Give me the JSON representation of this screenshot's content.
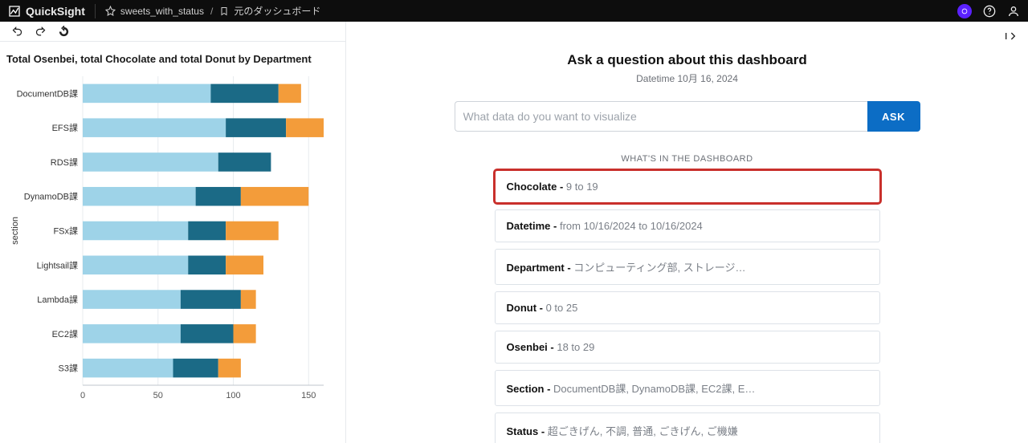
{
  "topbar": {
    "brand": "QuickSight",
    "crumb1": "sweets_with_status",
    "crumb2": "元のダッシュボード"
  },
  "ask": {
    "title": "Ask a question about this dashboard",
    "subtitle": "Datetime 10月 16, 2024",
    "placeholder": "What data do you want to visualize",
    "button": "ASK",
    "sectionHeader": "WHAT'S IN THE DASHBOARD",
    "items": [
      {
        "key": "Chocolate",
        "val": "9 to 19",
        "highlight": true
      },
      {
        "key": "Datetime",
        "val": "from 10/16/2024 to 10/16/2024"
      },
      {
        "key": "Department",
        "val": "コンピューティング部, ストレージ…"
      },
      {
        "key": "Donut",
        "val": "0 to 25"
      },
      {
        "key": "Osenbei",
        "val": "18 to 29"
      },
      {
        "key": "Section",
        "val": "DocumentDB課, DynamoDB課, EC2課, E…"
      },
      {
        "key": "Status",
        "val": "超ごきげん, 不調, 普通, ごきげん, ご機嫌"
      }
    ]
  },
  "chart_data": {
    "type": "bar",
    "orientation": "horizontal",
    "stacked": true,
    "title": "Total Osenbei, total Chocolate and total Donut by Department",
    "ylabel": "section",
    "xlabel": "",
    "xlim": [
      0,
      160
    ],
    "xticks": [
      0,
      50,
      100,
      150
    ],
    "categories": [
      "DocumentDB課",
      "EFS課",
      "RDS課",
      "DynamoDB課",
      "FSx課",
      "Lightsail課",
      "Lambda課",
      "EC2課",
      "S3課"
    ],
    "series": [
      {
        "name": "Osenbei",
        "color": "#9ed3e8",
        "values": [
          85,
          95,
          90,
          75,
          70,
          70,
          65,
          65,
          60
        ]
      },
      {
        "name": "Chocolate",
        "color": "#1b6a86",
        "values": [
          45,
          40,
          35,
          30,
          25,
          25,
          40,
          35,
          30
        ]
      },
      {
        "name": "Donut",
        "color": "#f39c3a",
        "values": [
          15,
          25,
          0,
          45,
          35,
          25,
          10,
          15,
          15
        ]
      }
    ]
  }
}
